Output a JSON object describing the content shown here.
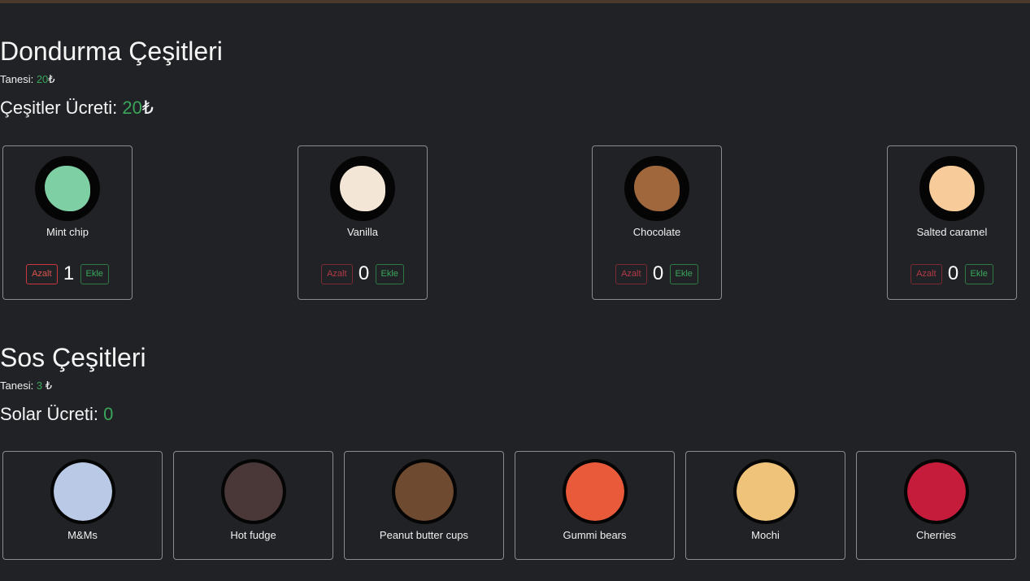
{
  "ice_section": {
    "title": "Dondurma Çeşitleri",
    "unit_label": "Tanesi:",
    "unit_price": "20",
    "currency": "₺",
    "total_label": "Çeşitler Ücreti:",
    "total_value": "20",
    "total_currency": "₺",
    "items": [
      {
        "name": "Mint chip",
        "qty": "1",
        "color": "#7fcfa4",
        "dec_label": "Azalt",
        "inc_label": "Ekle"
      },
      {
        "name": "Vanilla",
        "qty": "0",
        "color": "#f3e6d6",
        "dec_label": "Azalt",
        "inc_label": "Ekle"
      },
      {
        "name": "Chocolate",
        "qty": "0",
        "color": "#a0673c",
        "dec_label": "Azalt",
        "inc_label": "Ekle"
      },
      {
        "name": "Salted caramel",
        "qty": "0",
        "color": "#f8cc9a",
        "dec_label": "Azalt",
        "inc_label": "Ekle"
      }
    ]
  },
  "sauce_section": {
    "title": "Sos Çeşitleri",
    "unit_label": "Tanesi:",
    "unit_price": "3",
    "currency": "₺",
    "total_label": "Solar Ücreti:",
    "total_value": "0",
    "items": [
      {
        "name": "M&Ms",
        "color": "#b9c9e6"
      },
      {
        "name": "Hot fudge",
        "color": "#4a3838"
      },
      {
        "name": "Peanut butter cups",
        "color": "#6e4a30"
      },
      {
        "name": "Gummi bears",
        "color": "#e85a3a"
      },
      {
        "name": "Mochi",
        "color": "#f0c37a"
      },
      {
        "name": "Cherries",
        "color": "#c41c3a"
      }
    ]
  },
  "colors": {
    "background": "#212226",
    "accent_green": "#3aa65a",
    "danger_red": "#c9383f"
  }
}
